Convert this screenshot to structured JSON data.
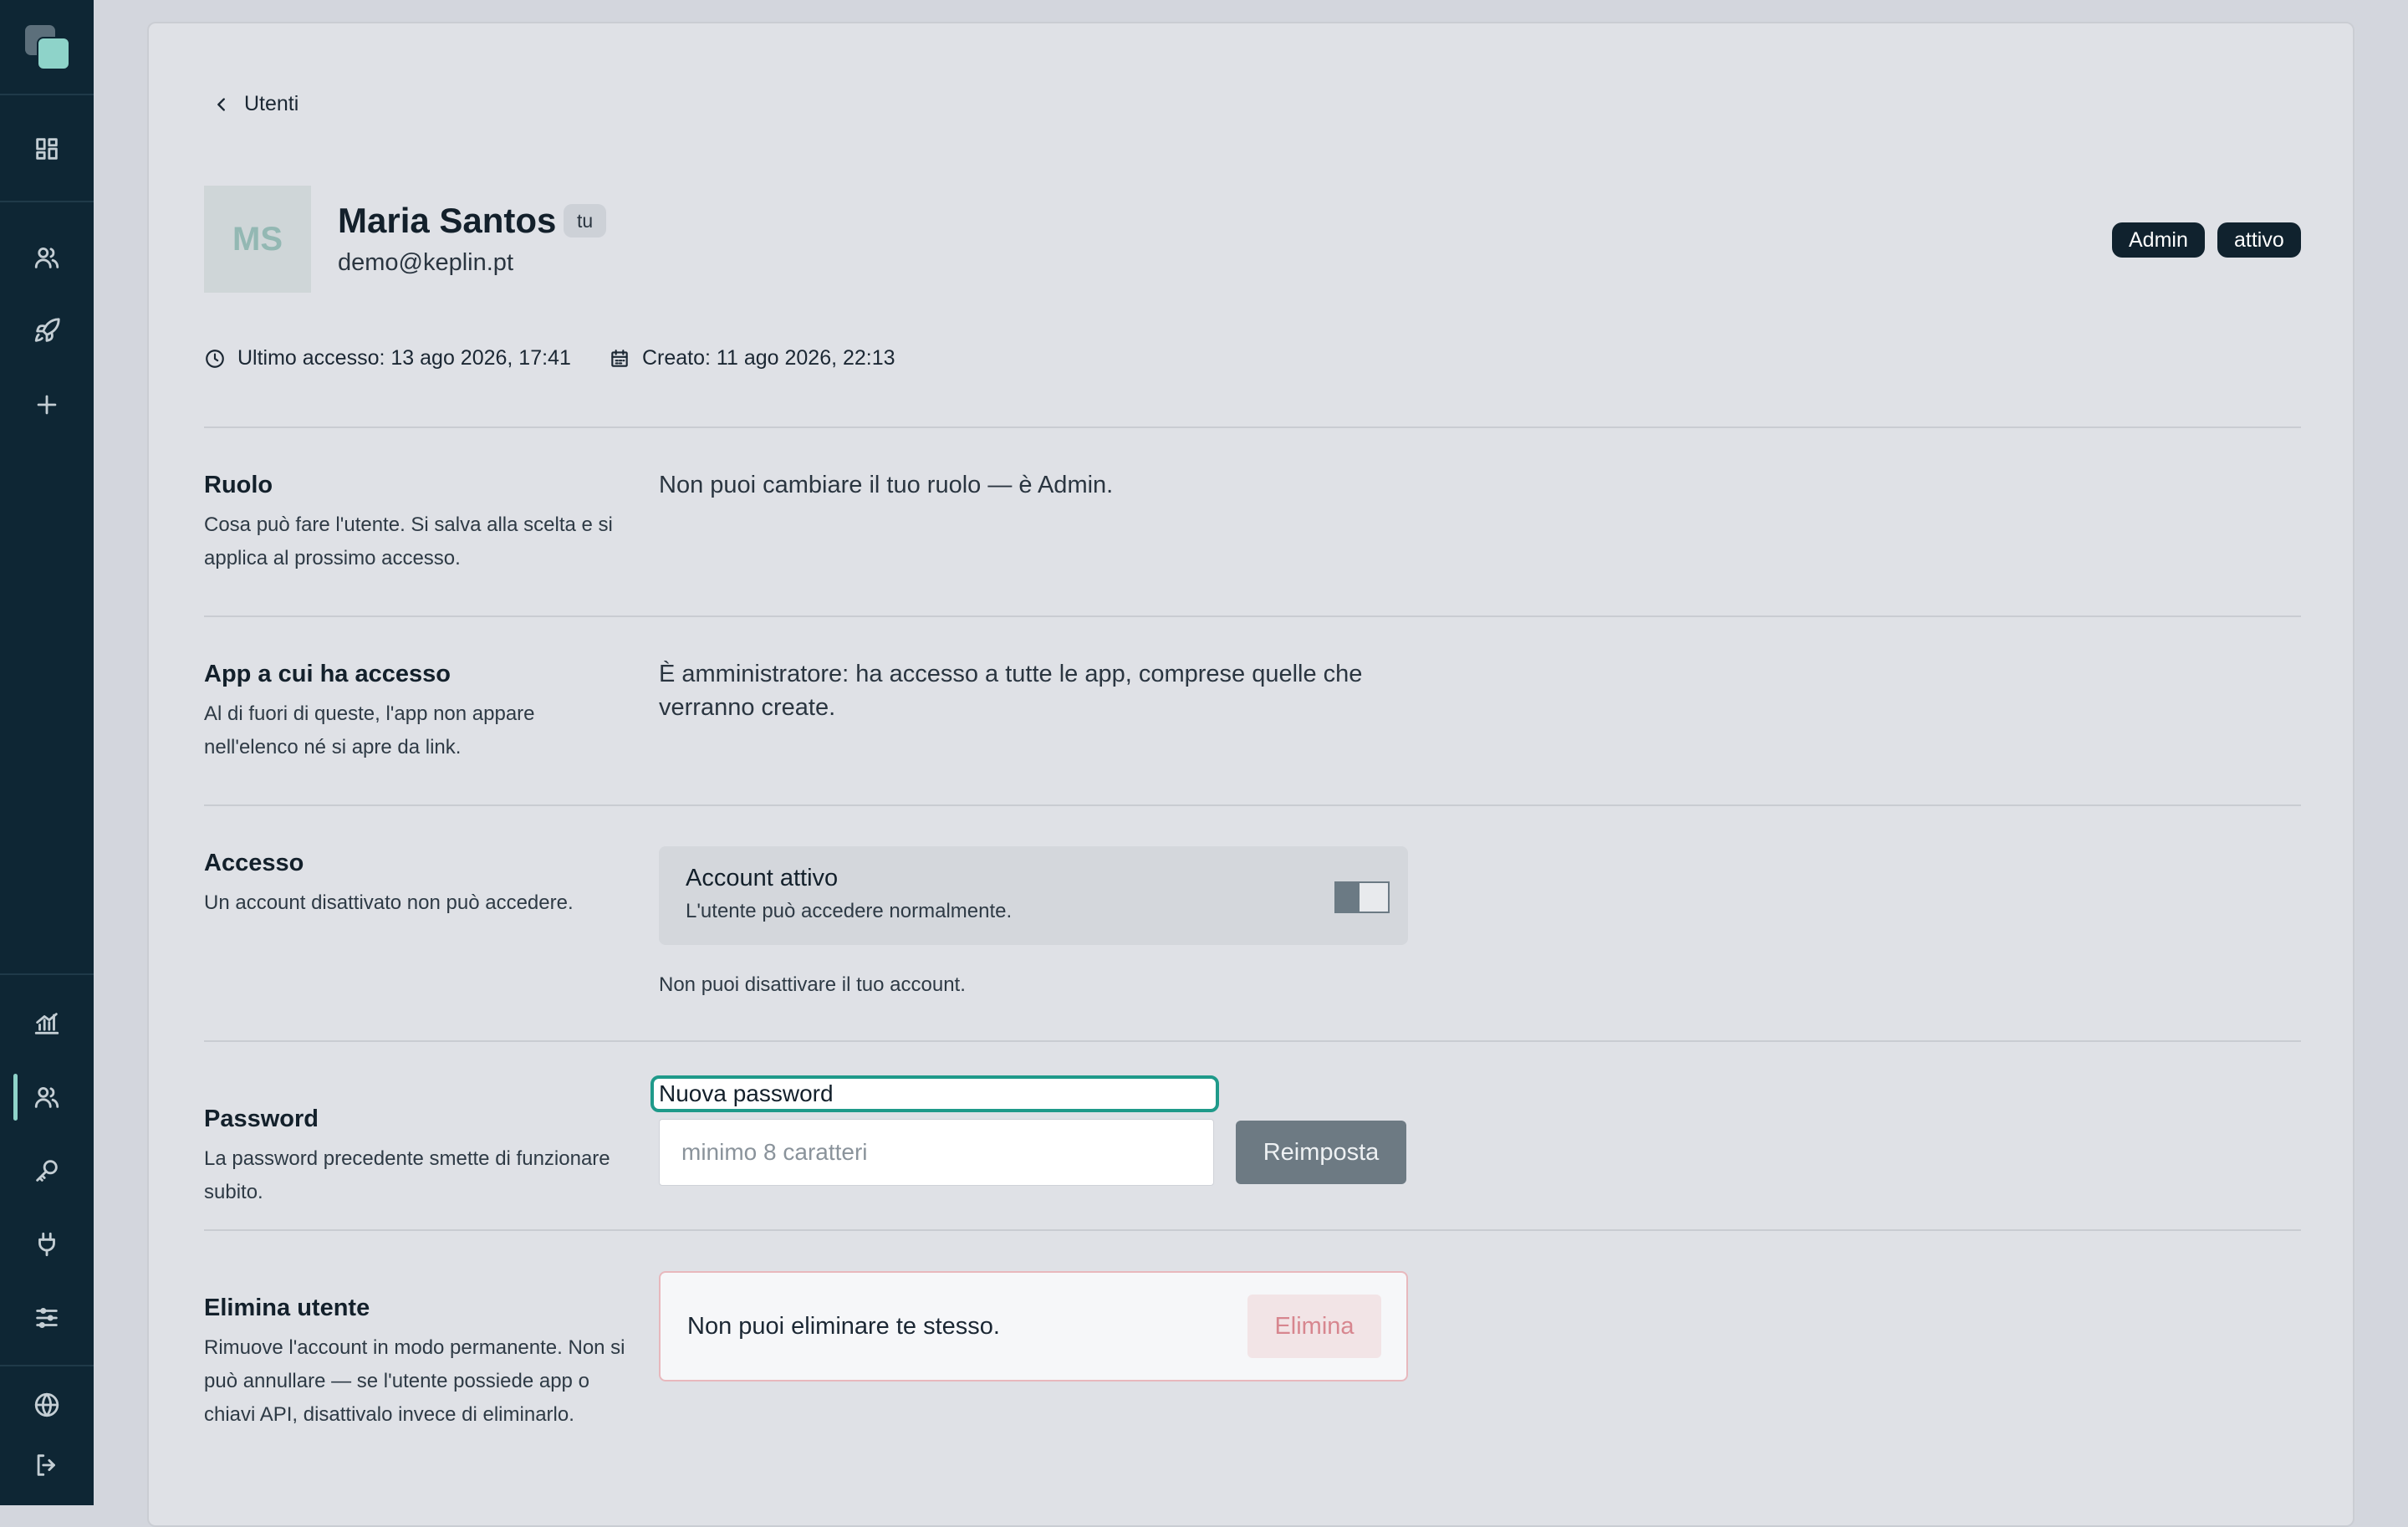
{
  "back_label": "Utenti",
  "user": {
    "initials": "MS",
    "name": "Maria Santos",
    "self_tag": "tu",
    "email": "demo@keplin.pt",
    "role_badge": "Admin",
    "status_badge": "attivo",
    "last_access": "Ultimo accesso: 13 ago 2026, 17:41",
    "created": "Creato: 11 ago 2026, 22:13"
  },
  "sections": {
    "role": {
      "title": "Ruolo",
      "desc": "Cosa può fare l'utente. Si salva alla scelta e si applica al prossimo accesso.",
      "text": "Non puoi cambiare il tuo ruolo — è Admin."
    },
    "apps": {
      "title": "App a cui ha accesso",
      "desc": "Al di fuori di queste, l'app non appare nell'elenco né si apre da link.",
      "text": "È amministratore: ha accesso a tutte le app, comprese quelle che verranno create."
    },
    "access": {
      "title": "Accesso",
      "desc": "Un account disattivato non può accedere.",
      "toggle_title": "Account attivo",
      "toggle_sub": "L'utente può accedere normalmente.",
      "note": "Non puoi disattivare il tuo account."
    },
    "password": {
      "title": "Password",
      "desc": "La password precedente smette di funzionare subito.",
      "field_label": "Nuova password",
      "placeholder": "minimo 8 caratteri",
      "button": "Reimposta"
    },
    "delete": {
      "title": "Elimina utente",
      "desc": "Rimuove l'account in modo permanente. Non si può annullare — se l'utente possiede app o chiavi API, disattivalo invece di eliminarlo.",
      "text": "Non puoi eliminare te stesso.",
      "button": "Elimina"
    }
  },
  "colors": {
    "sidebar": "#0e2634",
    "accent": "#8ed3c9",
    "focus": "#1f9a8a",
    "danger": "#d7868f"
  },
  "icons": [
    "dashboard-icon",
    "users-icon",
    "rocket-icon",
    "plus-icon",
    "chart-icon",
    "users-icon",
    "key-icon",
    "plug-icon",
    "sliders-icon",
    "globe-icon",
    "logout-icon",
    "clock-icon",
    "calendar-icon",
    "chevron-left-icon"
  ]
}
